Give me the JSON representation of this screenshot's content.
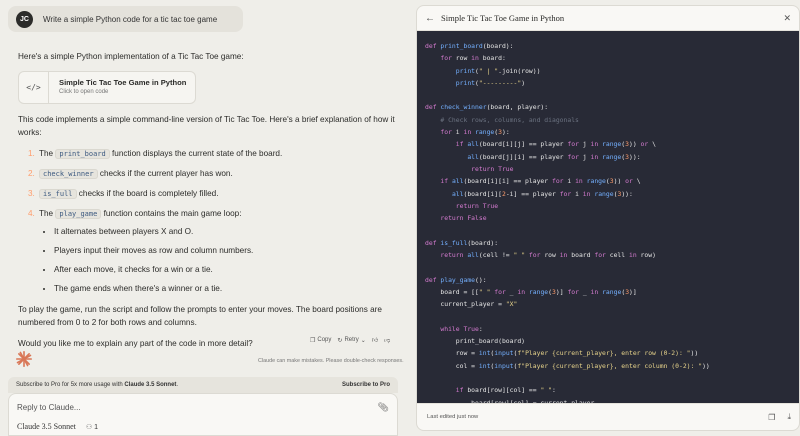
{
  "user": {
    "initials": "JC",
    "message": "Write a simple Python code for a tic tac toe game"
  },
  "response": {
    "intro": "Here's a simple Python implementation of a Tic Tac Toe game:",
    "artifact": {
      "title": "Simple Tic Tac Toe Game in Python",
      "subtitle": "Click to open code",
      "icon": "</>"
    },
    "explanation": "This code implements a simple command-line version of Tic Tac Toe. Here's a brief explanation of how it works:",
    "steps": [
      {
        "num": "1.",
        "pre": "The ",
        "code": "print_board",
        "post": " function displays the current state of the board."
      },
      {
        "num": "2.",
        "pre": "",
        "code": "check_winner",
        "post": " checks if the current player has won."
      },
      {
        "num": "3.",
        "pre": "",
        "code": "is_full",
        "post": " checks if the board is completely filled."
      },
      {
        "num": "4.",
        "pre": "The ",
        "code": "play_game",
        "post": " function contains the main game loop:"
      }
    ],
    "sub_steps": [
      "It alternates between players X and O.",
      "Players input their moves as row and column numbers.",
      "After each move, it checks for a win or a tie.",
      "The game ends when there's a winner or a tie."
    ],
    "outro": "To play the game, run the script and follow the prompts to enter your moves. The board positions are numbered from 0 to 2 for both rows and columns.",
    "question": "Would you like me to explain any part of the code in more detail?"
  },
  "actions": {
    "copy": "Copy",
    "retry": "Retry"
  },
  "disclaimer": "Claude can make mistakes. Please double-check responses.",
  "banner": {
    "text_pre": "Subscribe to Pro for 5x more usage with ",
    "text_bold": "Claude 3.5 Sonnet",
    "text_post": ".",
    "cta": "Subscribe to Pro"
  },
  "composer": {
    "placeholder": "Reply to Claude...",
    "model": "Claude 3.5 Sonnet",
    "count": "1"
  },
  "panel": {
    "title": "Simple Tic Tac Toe Game in Python",
    "footer": "Last edited just now",
    "code": [
      [
        [
          "kw",
          "def "
        ],
        [
          "fn",
          "print_board"
        ],
        [
          "t",
          "(board):"
        ]
      ],
      [
        [
          "t",
          "    "
        ],
        [
          "kw",
          "for "
        ],
        [
          "t",
          "row "
        ],
        [
          "kw",
          "in "
        ],
        [
          "t",
          "board:"
        ]
      ],
      [
        [
          "t",
          "        "
        ],
        [
          "fn",
          "print"
        ],
        [
          "t",
          "("
        ],
        [
          "str",
          "\" | \""
        ],
        [
          "t",
          ".join(row))"
        ]
      ],
      [
        [
          "t",
          "        "
        ],
        [
          "fn",
          "print"
        ],
        [
          "t",
          "("
        ],
        [
          "str",
          "\"---------\""
        ],
        [
          "t",
          ")"
        ]
      ],
      [
        [
          "t",
          ""
        ]
      ],
      [
        [
          "kw",
          "def "
        ],
        [
          "fn",
          "check_winner"
        ],
        [
          "t",
          "(board, player):"
        ]
      ],
      [
        [
          "t",
          "    "
        ],
        [
          "cm",
          "# Check rows, columns, and diagonals"
        ]
      ],
      [
        [
          "t",
          "    "
        ],
        [
          "kw",
          "for "
        ],
        [
          "t",
          "i "
        ],
        [
          "kw",
          "in "
        ],
        [
          "fn",
          "range"
        ],
        [
          "t",
          "("
        ],
        [
          "num",
          "3"
        ],
        [
          "t",
          "):"
        ]
      ],
      [
        [
          "t",
          "        "
        ],
        [
          "kw",
          "if "
        ],
        [
          "fn",
          "all"
        ],
        [
          "t",
          "(board[i][j] == player "
        ],
        [
          "kw",
          "for "
        ],
        [
          "t",
          "j "
        ],
        [
          "kw",
          "in "
        ],
        [
          "fn",
          "range"
        ],
        [
          "t",
          "("
        ],
        [
          "num",
          "3"
        ],
        [
          "t",
          ")) "
        ],
        [
          "kw",
          "or "
        ],
        [
          "t",
          "\\"
        ]
      ],
      [
        [
          "t",
          "           "
        ],
        [
          "fn",
          "all"
        ],
        [
          "t",
          "(board[j][i] == player "
        ],
        [
          "kw",
          "for "
        ],
        [
          "t",
          "j "
        ],
        [
          "kw",
          "in "
        ],
        [
          "fn",
          "range"
        ],
        [
          "t",
          "("
        ],
        [
          "num",
          "3"
        ],
        [
          "t",
          "))"
        ],
        [
          "t",
          ":"
        ]
      ],
      [
        [
          "t",
          "            "
        ],
        [
          "kw",
          "return "
        ],
        [
          "kw",
          "True"
        ]
      ],
      [
        [
          "t",
          "    "
        ],
        [
          "kw",
          "if "
        ],
        [
          "fn",
          "all"
        ],
        [
          "t",
          "(board[i][i] == player "
        ],
        [
          "kw",
          "for "
        ],
        [
          "t",
          "i "
        ],
        [
          "kw",
          "in "
        ],
        [
          "fn",
          "range"
        ],
        [
          "t",
          "("
        ],
        [
          "num",
          "3"
        ],
        [
          "t",
          ")) "
        ],
        [
          "kw",
          "or "
        ],
        [
          "t",
          "\\"
        ]
      ],
      [
        [
          "t",
          "       "
        ],
        [
          "fn",
          "all"
        ],
        [
          "t",
          "(board[i]["
        ],
        [
          "num",
          "2"
        ],
        [
          "t",
          "-i] == player "
        ],
        [
          "kw",
          "for "
        ],
        [
          "t",
          "i "
        ],
        [
          "kw",
          "in "
        ],
        [
          "fn",
          "range"
        ],
        [
          "t",
          "("
        ],
        [
          "num",
          "3"
        ],
        [
          "t",
          "))"
        ],
        [
          "t",
          ":"
        ]
      ],
      [
        [
          "t",
          "        "
        ],
        [
          "kw",
          "return "
        ],
        [
          "kw",
          "True"
        ]
      ],
      [
        [
          "t",
          "    "
        ],
        [
          "kw",
          "return "
        ],
        [
          "kw",
          "False"
        ]
      ],
      [
        [
          "t",
          ""
        ]
      ],
      [
        [
          "kw",
          "def "
        ],
        [
          "fn",
          "is_full"
        ],
        [
          "t",
          "(board):"
        ]
      ],
      [
        [
          "t",
          "    "
        ],
        [
          "kw",
          "return "
        ],
        [
          "fn",
          "all"
        ],
        [
          "t",
          "(cell != "
        ],
        [
          "str",
          "\" \""
        ],
        [
          "t",
          " "
        ],
        [
          "kw",
          "for "
        ],
        [
          "t",
          "row "
        ],
        [
          "kw",
          "in "
        ],
        [
          "t",
          "board "
        ],
        [
          "kw",
          "for "
        ],
        [
          "t",
          "cell "
        ],
        [
          "kw",
          "in "
        ],
        [
          "t",
          "row)"
        ]
      ],
      [
        [
          "t",
          ""
        ]
      ],
      [
        [
          "kw",
          "def "
        ],
        [
          "fn",
          "play_game"
        ],
        [
          "t",
          "():"
        ]
      ],
      [
        [
          "t",
          "    board = [["
        ],
        [
          "str",
          "\" \""
        ],
        [
          "t",
          " "
        ],
        [
          "kw",
          "for "
        ],
        [
          "t",
          "_ "
        ],
        [
          "kw",
          "in "
        ],
        [
          "fn",
          "range"
        ],
        [
          "t",
          "("
        ],
        [
          "num",
          "3"
        ],
        [
          "t",
          ")] "
        ],
        [
          "kw",
          "for "
        ],
        [
          "t",
          "_ "
        ],
        [
          "kw",
          "in "
        ],
        [
          "fn",
          "range"
        ],
        [
          "t",
          "("
        ],
        [
          "num",
          "3"
        ],
        [
          "t",
          ")]"
        ]
      ],
      [
        [
          "t",
          "    current_player = "
        ],
        [
          "str",
          "\"X\""
        ]
      ],
      [
        [
          "t",
          ""
        ]
      ],
      [
        [
          "t",
          "    "
        ],
        [
          "kw",
          "while "
        ],
        [
          "kw",
          "True"
        ],
        [
          "t",
          ":"
        ]
      ],
      [
        [
          "t",
          "        print_board(board)"
        ]
      ],
      [
        [
          "t",
          "        row = "
        ],
        [
          "fn",
          "int"
        ],
        [
          "t",
          "("
        ],
        [
          "fn",
          "input"
        ],
        [
          "t",
          "("
        ],
        [
          "str",
          "f\"Player {current_player}, enter row (0-2): \""
        ],
        [
          "t",
          "))"
        ]
      ],
      [
        [
          "t",
          "        col = "
        ],
        [
          "fn",
          "int"
        ],
        [
          "t",
          "("
        ],
        [
          "fn",
          "input"
        ],
        [
          "t",
          "("
        ],
        [
          "str",
          "f\"Player {current_player}, enter column (0-2): \""
        ],
        [
          "t",
          "))"
        ]
      ],
      [
        [
          "t",
          ""
        ]
      ],
      [
        [
          "t",
          "        "
        ],
        [
          "kw",
          "if "
        ],
        [
          "t",
          "board[row][col] == "
        ],
        [
          "str",
          "\" \""
        ],
        [
          "t",
          ":"
        ]
      ],
      [
        [
          "t",
          "            board[row][col] = current_player"
        ]
      ]
    ]
  }
}
